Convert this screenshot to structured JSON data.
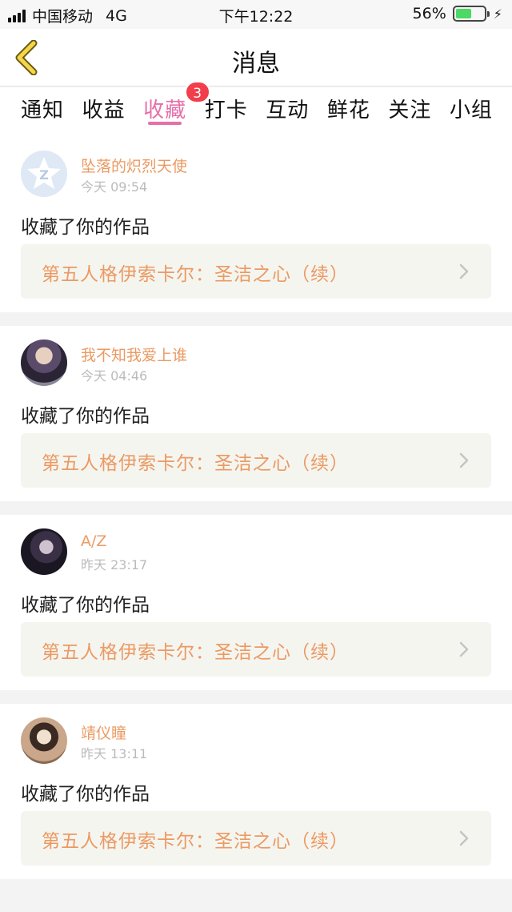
{
  "status_bar": {
    "carrier": "中国移动",
    "network": "4G",
    "time": "下午12:22",
    "battery_percent_text": "56%",
    "battery_level": 0.56
  },
  "nav": {
    "title": "消息"
  },
  "tabs": [
    {
      "label": "通知"
    },
    {
      "label": "收益"
    },
    {
      "label": "收藏",
      "badge": "3"
    },
    {
      "label": "打卡"
    },
    {
      "label": "互动"
    },
    {
      "label": "鲜花"
    },
    {
      "label": "关注"
    },
    {
      "label": "小组"
    }
  ],
  "colors": {
    "accent_pink": "#e76fa8",
    "username_orange": "#eb9a63",
    "badge_red": "#f23e4b",
    "back_yellow": "#f3d64a"
  },
  "items": [
    {
      "username": "坠落的炽烈天使",
      "time": "今天 09:54",
      "action": "收藏了你的作品",
      "work_title": "第五人格伊索卡尔：圣洁之心（续）"
    },
    {
      "username": "我不知我爱上谁",
      "time": "今天 04:46",
      "action": "收藏了你的作品",
      "work_title": "第五人格伊索卡尔：圣洁之心（续）"
    },
    {
      "username": "A/Z",
      "time": "昨天 23:17",
      "action": "收藏了你的作品",
      "work_title": "第五人格伊索卡尔：圣洁之心（续）"
    },
    {
      "username": "靖仪瞳",
      "time": "昨天 13:11",
      "action": "收藏了你的作品",
      "work_title": "第五人格伊索卡尔：圣洁之心（续）"
    }
  ]
}
